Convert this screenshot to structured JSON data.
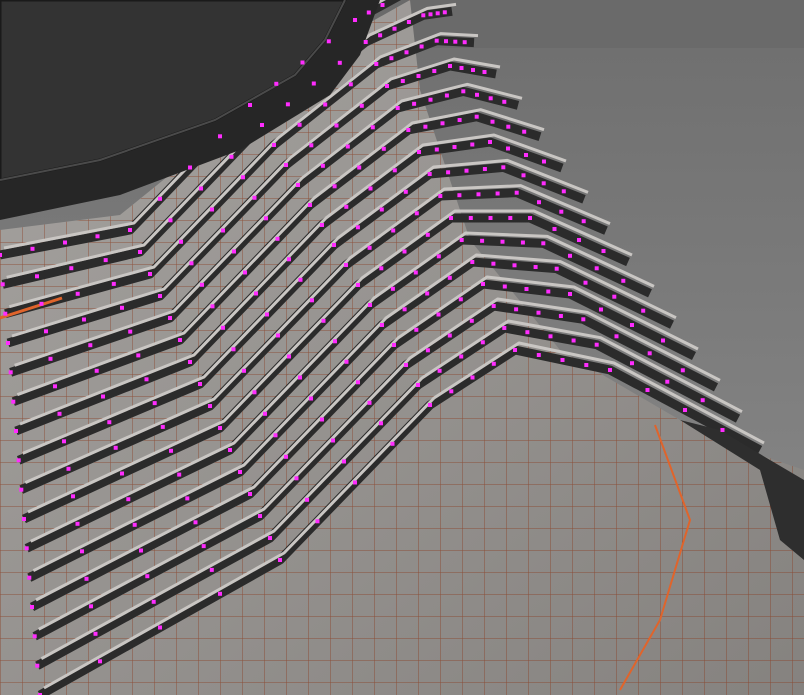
{
  "viewport": {
    "background_top": "#6e6e6e",
    "background_bottom": "#8c8c8c",
    "model": {
      "surface_color": "#8e8b88",
      "surface_light": "#c9c6c3",
      "groove_color": "#2b2b2b",
      "cap_color": "#3a3a3a",
      "cap_edge": "#1f1f1f",
      "uv_grid_color": "#8a3a1e",
      "seam_color": "#e0642b",
      "selected_vertex_color": "#ff2cff"
    }
  }
}
